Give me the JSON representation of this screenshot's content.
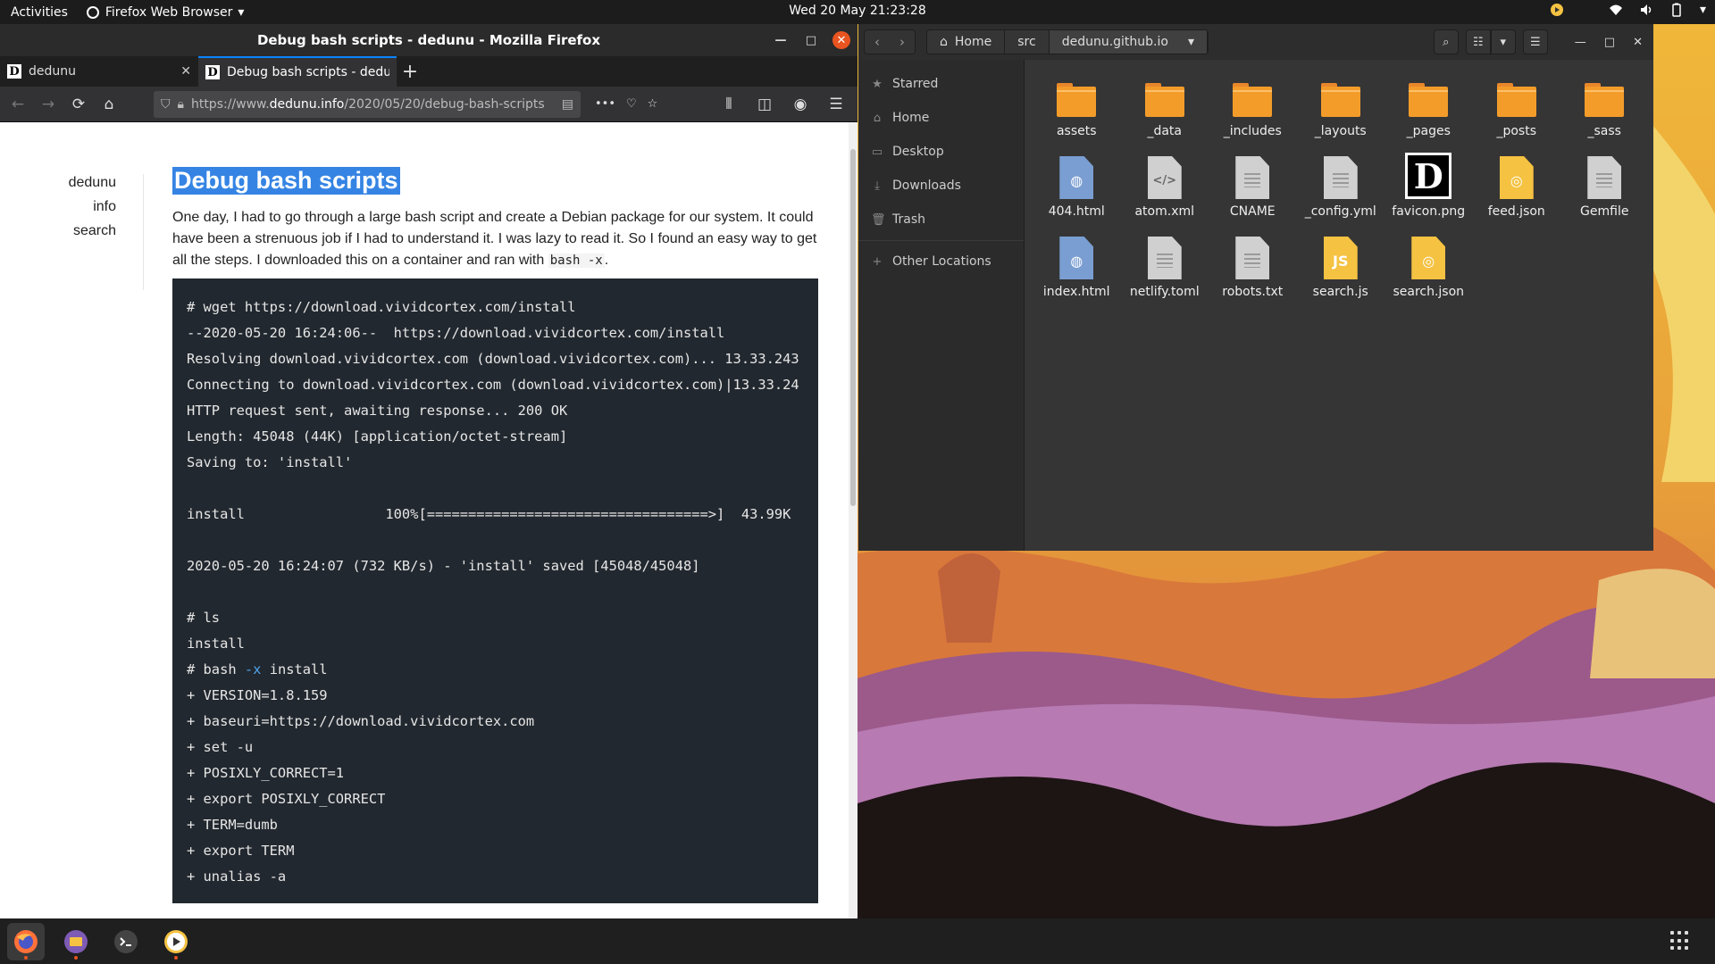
{
  "topbar": {
    "activities": "Activities",
    "app_name": "Firefox Web Browser",
    "clock": "Wed 20 May  21:23:28"
  },
  "firefox": {
    "window_title": "Debug bash scripts - dedunu - Mozilla Firefox",
    "tabs": [
      {
        "title": "dedunu"
      },
      {
        "title": "Debug bash scripts - dedunu"
      }
    ],
    "url_prefix": "https://www.",
    "url_domain": "dedunu.info",
    "url_path": "/2020/05/20/debug-bash-scripts"
  },
  "page": {
    "nav": [
      "dedunu",
      "info",
      "search"
    ],
    "title": "Debug bash scripts",
    "intro": "One day, I had to go through a large bash script and create a Debian package for our system. It could have been a strenuous job if I had to understand it. I was lazy to read it. So I found an easy way to get all the steps. I downloaded this on a container and ran with",
    "intro_code": "bash -x",
    "intro_end": ".",
    "code_lines": [
      "# wget https://download.vividcortex.com/install",
      "--2020-05-20 16:24:06--  https://download.vividcortex.com/install",
      "Resolving download.vividcortex.com (download.vividcortex.com)... 13.33.243",
      "Connecting to download.vividcortex.com (download.vividcortex.com)|13.33.24",
      "HTTP request sent, awaiting response... 200 OK",
      "Length: 45048 (44K) [application/octet-stream]",
      "Saving to: 'install'",
      "",
      "install                 100%[==================================>]  43.99K",
      "",
      "2020-05-20 16:24:07 (732 KB/s) - 'install' saved [45048/45048]",
      "",
      "# ls",
      "install",
      "# bash -x install",
      "+ VERSION=1.8.159",
      "+ baseuri=https://download.vividcortex.com",
      "+ set -u",
      "+ POSIXLY_CORRECT=1",
      "+ export POSIXLY_CORRECT",
      "+ TERM=dumb",
      "+ export TERM",
      "+ unalias -a"
    ]
  },
  "files": {
    "path": [
      "Home",
      "src",
      "dedunu.github.io"
    ],
    "sidebar": [
      {
        "label": "Starred",
        "icon": "star-icon"
      },
      {
        "label": "Home",
        "icon": "home-icon"
      },
      {
        "label": "Desktop",
        "icon": "desktop-icon"
      },
      {
        "label": "Downloads",
        "icon": "download-icon"
      },
      {
        "label": "Trash",
        "icon": "trash-icon"
      },
      {
        "label": "Other Locations",
        "icon": "plus-icon"
      }
    ],
    "items": [
      {
        "name": "assets",
        "kind": "folder"
      },
      {
        "name": "_data",
        "kind": "folder"
      },
      {
        "name": "_includes",
        "kind": "folder"
      },
      {
        "name": "_layouts",
        "kind": "folder"
      },
      {
        "name": "_pages",
        "kind": "folder"
      },
      {
        "name": "_posts",
        "kind": "folder"
      },
      {
        "name": "_sass",
        "kind": "folder"
      },
      {
        "name": "404.html",
        "kind": "html"
      },
      {
        "name": "atom.xml",
        "kind": "xml"
      },
      {
        "name": "CNAME",
        "kind": "text"
      },
      {
        "name": "_config.yml",
        "kind": "text"
      },
      {
        "name": "favicon.png",
        "kind": "image"
      },
      {
        "name": "feed.json",
        "kind": "json"
      },
      {
        "name": "Gemfile",
        "kind": "text"
      },
      {
        "name": "index.html",
        "kind": "html"
      },
      {
        "name": "netlify.toml",
        "kind": "text"
      },
      {
        "name": "robots.txt",
        "kind": "text"
      },
      {
        "name": "search.js",
        "kind": "js"
      },
      {
        "name": "search.json",
        "kind": "json"
      }
    ]
  },
  "colors": {
    "accent": "#e95420",
    "selection": "#3584e4",
    "folder": "#f39c2a"
  }
}
